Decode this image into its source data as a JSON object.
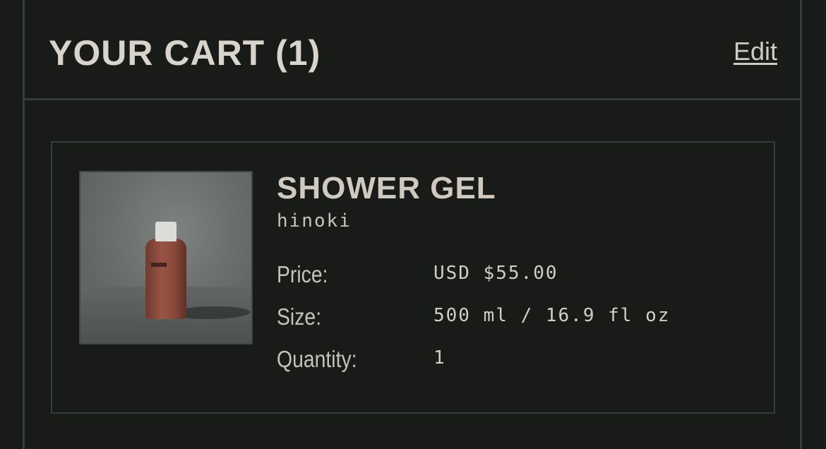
{
  "cart": {
    "title": "YOUR CART (1)",
    "edit_label": "Edit"
  },
  "item": {
    "image_alt": "shower gel bottle",
    "name": "SHOWER GEL",
    "variant": "hinoki",
    "details": [
      {
        "label": "Price:",
        "value": "USD $55.00"
      },
      {
        "label": "Size:",
        "value": "500 ml / 16.9 fl oz"
      },
      {
        "label": "Quantity:",
        "value": "1"
      }
    ]
  }
}
